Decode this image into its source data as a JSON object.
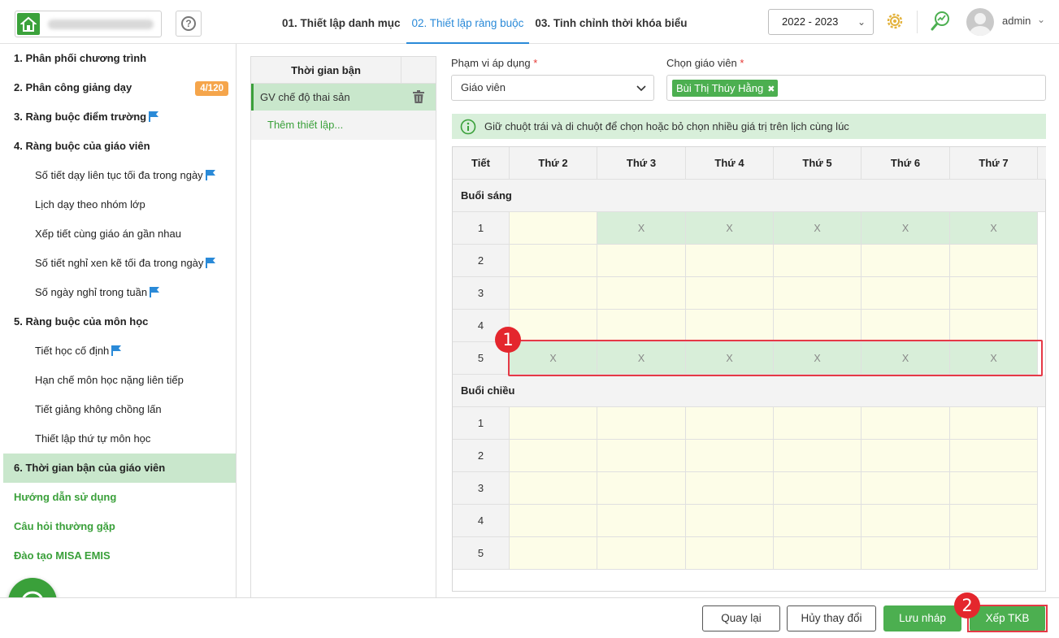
{
  "header": {
    "tabs": [
      {
        "label": "01. Thiết lập danh mục"
      },
      {
        "label": "02. Thiết lập ràng buộc"
      },
      {
        "label": "03. Tinh chỉnh thời khóa biểu"
      }
    ],
    "year": "2022 - 2023",
    "username": "admin"
  },
  "sidebar": {
    "items": [
      {
        "label": "1. Phân phối chương trình"
      },
      {
        "label": "2. Phân công giảng dạy",
        "badge": "4/120"
      },
      {
        "label": "3. Ràng buộc điểm trường"
      },
      {
        "label": "4. Ràng buộc của giáo viên"
      },
      {
        "label": "Số tiết dạy liên tục tối đa trong ngày"
      },
      {
        "label": "Lịch dạy theo nhóm lớp"
      },
      {
        "label": "Xếp tiết cùng giáo án gần nhau"
      },
      {
        "label": "Số tiết nghỉ xen kẽ tối đa trong ngày"
      },
      {
        "label": "Số ngày nghỉ trong tuần"
      },
      {
        "label": "5. Ràng buộc của môn học"
      },
      {
        "label": "Tiết học cố định"
      },
      {
        "label": "Hạn chế môn học nặng liên tiếp"
      },
      {
        "label": "Tiết giảng không chồng lấn"
      },
      {
        "label": "Thiết lập thứ tự môn học"
      },
      {
        "label": "6. Thời gian bận của giáo viên"
      },
      {
        "label": "Hướng dẫn sử dụng"
      },
      {
        "label": "Câu hỏi thường gặp"
      },
      {
        "label": "Đào tạo MISA EMIS"
      }
    ]
  },
  "settings_list": {
    "header": "Thời gian bận",
    "items": [
      {
        "label": "GV chế độ thai sản"
      }
    ],
    "add_label": "Thêm thiết lập..."
  },
  "form": {
    "scope_label": "Phạm vi áp dụng",
    "scope_value": "Giáo viên",
    "teacher_label": "Chọn giáo viên",
    "teacher_chip": "Bùi Thị Thúy Hằng",
    "required_mark": "*",
    "hint": "Giữ chuột trái và di chuột để chọn hoặc bỏ chọn nhiều giá trị trên lịch cùng lúc"
  },
  "grid": {
    "period_header": "Tiết",
    "days": [
      "Thứ 2",
      "Thứ 3",
      "Thứ 4",
      "Thứ 5",
      "Thứ 6",
      "Thứ 7"
    ],
    "busy_mark": "X",
    "sessions": [
      {
        "name": "Buổi sáng",
        "rows": [
          {
            "period": "1",
            "busy": [
              false,
              true,
              true,
              true,
              true,
              true
            ]
          },
          {
            "period": "2",
            "busy": [
              false,
              false,
              false,
              false,
              false,
              false
            ]
          },
          {
            "period": "3",
            "busy": [
              false,
              false,
              false,
              false,
              false,
              false
            ]
          },
          {
            "period": "4",
            "busy": [
              false,
              false,
              false,
              false,
              false,
              false
            ]
          },
          {
            "period": "5",
            "busy": [
              true,
              true,
              true,
              true,
              true,
              true
            ]
          }
        ]
      },
      {
        "name": "Buổi chiều",
        "rows": [
          {
            "period": "1",
            "busy": [
              false,
              false,
              false,
              false,
              false,
              false
            ]
          },
          {
            "period": "2",
            "busy": [
              false,
              false,
              false,
              false,
              false,
              false
            ]
          },
          {
            "period": "3",
            "busy": [
              false,
              false,
              false,
              false,
              false,
              false
            ]
          },
          {
            "period": "4",
            "busy": [
              false,
              false,
              false,
              false,
              false,
              false
            ]
          },
          {
            "period": "5",
            "busy": [
              false,
              false,
              false,
              false,
              false,
              false
            ]
          }
        ]
      }
    ]
  },
  "annotations": {
    "step1": "1",
    "step2": "2",
    "highlight_color": "#e53946"
  },
  "footer": {
    "back": "Quay lại",
    "cancel": "Hủy thay đổi",
    "save_draft": "Lưu nháp",
    "schedule": "Xếp TKB"
  },
  "colors": {
    "accent_green": "#4caf50",
    "active_tab_blue": "#2a8ad8",
    "busy_cell": "#d8eed9",
    "free_cell": "#fdfde8"
  }
}
